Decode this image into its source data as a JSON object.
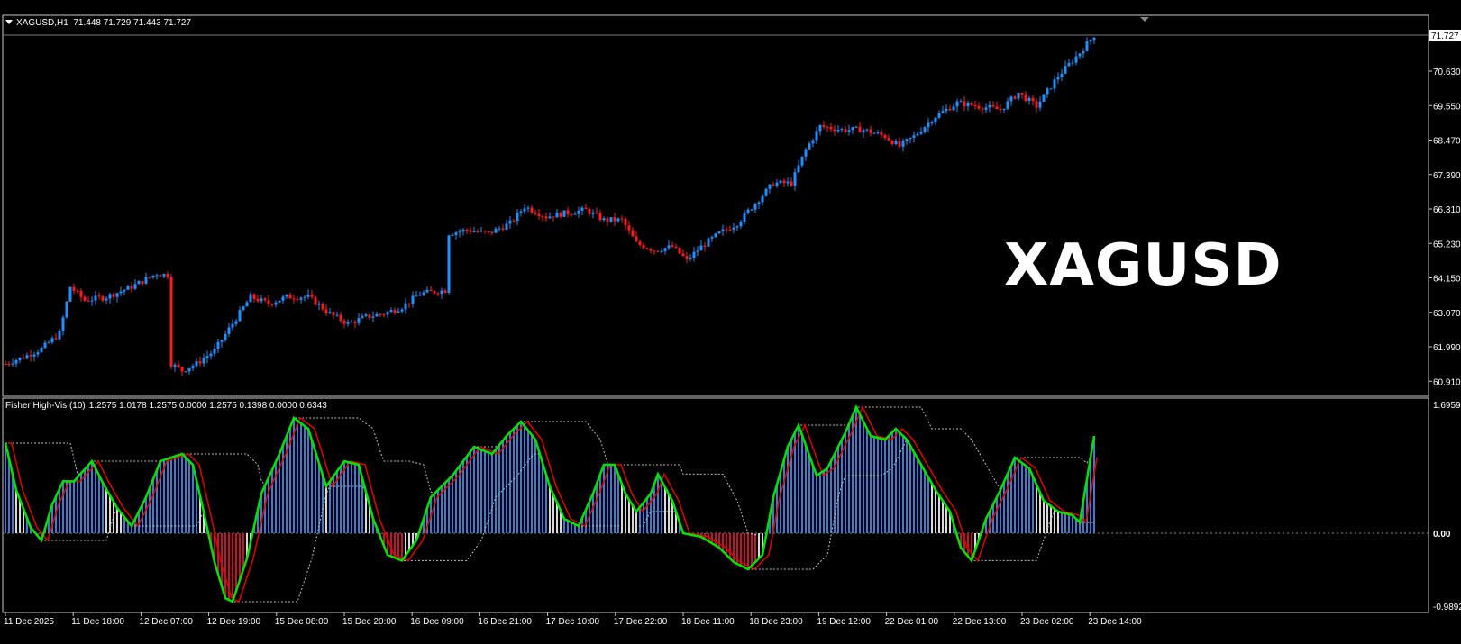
{
  "header": {
    "symbol": "XAGUSD,H1",
    "ohlc": "71.448 71.729 71.443 71.727"
  },
  "watermark": "XAGUSD",
  "price_axis": {
    "current_price": "71.727",
    "ticks": [
      "70.630",
      "69.550",
      "68.470",
      "67.390",
      "66.310",
      "65.230",
      "64.150",
      "63.070",
      "61.990",
      "60.910"
    ]
  },
  "indicator": {
    "name": "Fisher High-Vis (10)",
    "values": "1.2575 1.0178 1.2575 0.0000 1.2575 0.1398 0.0000 0.6343",
    "ticks": [
      "1.6959",
      "0.00",
      "-0.9892"
    ]
  },
  "time_axis": [
    "11 Dec 2025",
    "11 Dec 18:00",
    "12 Dec 07:00",
    "12 Dec 19:00",
    "15 Dec 08:00",
    "15 Dec 20:00",
    "16 Dec 09:00",
    "16 Dec 21:00",
    "17 Dec 10:00",
    "17 Dec 22:00",
    "18 Dec 11:00",
    "18 Dec 23:00",
    "19 Dec 12:00",
    "22 Dec 01:00",
    "22 Dec 13:00",
    "23 Dec 02:00",
    "23 Dec 14:00"
  ],
  "colors": {
    "bull": "#1e90ff",
    "bear": "#ff1a1a",
    "fisher_line": "#00e600",
    "signal_line": "#e60000",
    "hist_up": "#3a7bd5",
    "hist_down": "#c8102e",
    "hist_neutral": "#d9d9d9",
    "grid": "#c0c0c0"
  },
  "chart_data": [
    {
      "type": "candlestick",
      "title": "XAGUSD,H1",
      "ylim": [
        60.55,
        71.9
      ],
      "current_price": 71.727,
      "close_path": [
        [
          0,
          61.9
        ],
        [
          5,
          62.1
        ],
        [
          10,
          62.35
        ],
        [
          15,
          62.8
        ],
        [
          18,
          64.2
        ],
        [
          22,
          63.8
        ],
        [
          28,
          63.9
        ],
        [
          35,
          64.2
        ],
        [
          42,
          64.6
        ],
        [
          45,
          64.55
        ],
        [
          46,
          61.9
        ],
        [
          49,
          61.7
        ],
        [
          53,
          61.9
        ],
        [
          58,
          62.3
        ],
        [
          63,
          63.1
        ],
        [
          68,
          63.9
        ],
        [
          73,
          63.7
        ],
        [
          78,
          63.9
        ],
        [
          84,
          63.9
        ],
        [
          90,
          63.4
        ],
        [
          95,
          63.1
        ],
        [
          100,
          63.3
        ],
        [
          105,
          63.4
        ],
        [
          110,
          63.6
        ],
        [
          115,
          64.0
        ],
        [
          122,
          64.1
        ],
        [
          123,
          65.8
        ],
        [
          128,
          65.9
        ],
        [
          134,
          65.8
        ],
        [
          140,
          66.1
        ],
        [
          144,
          66.6
        ],
        [
          150,
          66.3
        ],
        [
          155,
          66.4
        ],
        [
          161,
          66.5
        ],
        [
          166,
          66.2
        ],
        [
          171,
          66.2
        ],
        [
          175,
          65.5
        ],
        [
          180,
          65.3
        ],
        [
          185,
          65.4
        ],
        [
          189,
          65.0
        ],
        [
          193,
          65.4
        ],
        [
          198,
          65.8
        ],
        [
          203,
          66.1
        ],
        [
          208,
          66.7
        ],
        [
          213,
          67.3
        ],
        [
          218,
          67.3
        ],
        [
          222,
          68.3
        ],
        [
          226,
          69.0
        ],
        [
          232,
          68.9
        ],
        [
          238,
          68.9
        ],
        [
          244,
          68.7
        ],
        [
          248,
          68.4
        ],
        [
          252,
          68.7
        ],
        [
          258,
          69.3
        ],
        [
          264,
          69.7
        ],
        [
          270,
          69.6
        ],
        [
          276,
          69.5
        ],
        [
          281,
          70.0
        ],
        [
          286,
          69.6
        ],
        [
          292,
          70.5
        ],
        [
          298,
          71.2
        ],
        [
          302,
          71.727
        ]
      ]
    },
    {
      "type": "bar",
      "title": "Fisher High-Vis (10)",
      "ylim": [
        -0.9892,
        1.6959
      ],
      "fisher_path": [
        [
          0,
          1.25
        ],
        [
          3,
          0.6
        ],
        [
          7,
          0.08
        ],
        [
          10,
          -0.1
        ],
        [
          13,
          0.4
        ],
        [
          16,
          0.72
        ],
        [
          19,
          0.72
        ],
        [
          24,
          1.0
        ],
        [
          27,
          0.7
        ],
        [
          31,
          0.35
        ],
        [
          35,
          0.1
        ],
        [
          39,
          0.5
        ],
        [
          43,
          1.0
        ],
        [
          49,
          1.1
        ],
        [
          52,
          0.95
        ],
        [
          55,
          0.3
        ],
        [
          58,
          -0.4
        ],
        [
          61,
          -0.9
        ],
        [
          63,
          -0.95
        ],
        [
          67,
          -0.35
        ],
        [
          71,
          0.55
        ],
        [
          76,
          1.1
        ],
        [
          80,
          1.6
        ],
        [
          84,
          1.45
        ],
        [
          89,
          0.65
        ],
        [
          94,
          1.0
        ],
        [
          98,
          0.95
        ],
        [
          102,
          0.2
        ],
        [
          106,
          -0.3
        ],
        [
          110,
          -0.38
        ],
        [
          114,
          -0.1
        ],
        [
          118,
          0.5
        ],
        [
          124,
          0.8
        ],
        [
          130,
          1.2
        ],
        [
          135,
          1.1
        ],
        [
          139,
          1.35
        ],
        [
          143,
          1.55
        ],
        [
          147,
          1.3
        ],
        [
          151,
          0.65
        ],
        [
          155,
          0.2
        ],
        [
          159,
          0.1
        ],
        [
          163,
          0.55
        ],
        [
          166,
          0.95
        ],
        [
          169,
          0.95
        ],
        [
          172,
          0.55
        ],
        [
          175,
          0.3
        ],
        [
          179,
          0.55
        ],
        [
          181,
          0.82
        ],
        [
          185,
          0.45
        ],
        [
          188,
          0.0
        ],
        [
          193,
          -0.05
        ],
        [
          198,
          -0.2
        ],
        [
          202,
          -0.4
        ],
        [
          206,
          -0.5
        ],
        [
          210,
          -0.3
        ],
        [
          213,
          0.5
        ],
        [
          217,
          1.2
        ],
        [
          220,
          1.5
        ],
        [
          225,
          0.8
        ],
        [
          228,
          0.9
        ],
        [
          233,
          1.4
        ],
        [
          236,
          1.75
        ],
        [
          240,
          1.35
        ],
        [
          244,
          1.3
        ],
        [
          247,
          1.45
        ],
        [
          250,
          1.3
        ],
        [
          254,
          0.95
        ],
        [
          258,
          0.6
        ],
        [
          262,
          0.3
        ],
        [
          265,
          -0.2
        ],
        [
          268,
          -0.38
        ],
        [
          272,
          0.2
        ],
        [
          276,
          0.6
        ],
        [
          280,
          1.05
        ],
        [
          284,
          0.9
        ],
        [
          288,
          0.45
        ],
        [
          292,
          0.3
        ],
        [
          296,
          0.25
        ],
        [
          298,
          0.15
        ],
        [
          302,
          1.35
        ]
      ]
    }
  ]
}
